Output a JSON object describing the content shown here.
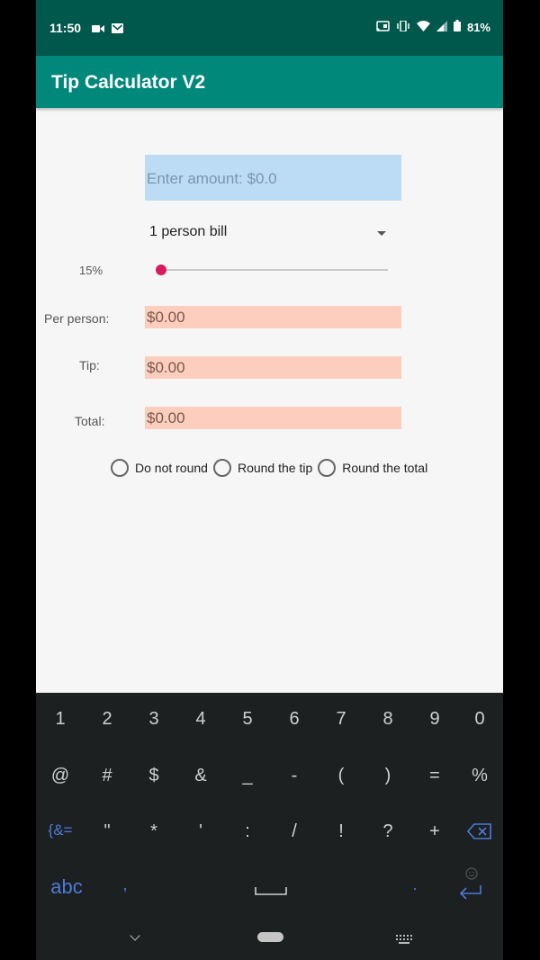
{
  "status_bar": {
    "time": "11:50",
    "battery": "81%",
    "left_icons": [
      "camera-icon",
      "gmail-icon"
    ],
    "right_icons": [
      "cast-icon",
      "vibrate-icon",
      "wifi-icon",
      "signal-icon",
      "battery-icon"
    ]
  },
  "app_bar": {
    "title": "Tip Calculator V2"
  },
  "form": {
    "amount_placeholder": "Enter amount: $0.0",
    "persons_selected": "1 person bill",
    "tip_percent_label": "15%",
    "tip_slider_fraction": 0.0,
    "per_person_label": "Per person:",
    "per_person_value": "$0.00",
    "tip_label": "Tip:",
    "tip_value": "$0.00",
    "total_label": "Total:",
    "total_value": "$0.00",
    "rounding_options": [
      "Do not round",
      "Round the tip",
      "Round the total"
    ]
  },
  "keyboard": {
    "row1": [
      "1",
      "2",
      "3",
      "4",
      "5",
      "6",
      "7",
      "8",
      "9",
      "0"
    ],
    "row2": [
      "@",
      "#",
      "$",
      "&",
      "_",
      "-",
      "(",
      ")",
      "=",
      "%"
    ],
    "row3": [
      "{&=",
      "\"",
      "*",
      "'",
      ":",
      "/",
      "!",
      "?",
      "+"
    ],
    "row4": {
      "abc": "abc",
      "comma": ",",
      "period": "."
    },
    "accent_color": "#4d7ad8"
  },
  "colors": {
    "status_bar": "#00574b",
    "app_bar": "#00897b",
    "amount_field": "#bcdcf6",
    "output_field": "#fdcebd",
    "slider_thumb": "#d81b60"
  }
}
